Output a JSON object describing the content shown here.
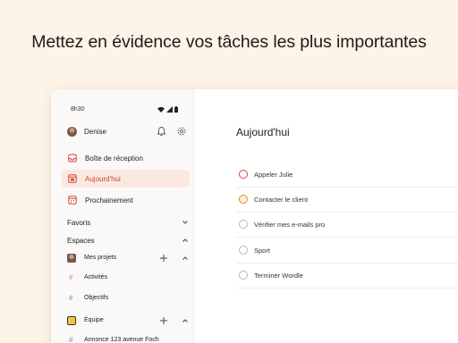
{
  "headline": "Mettez en évidence vos tâches les plus importantes",
  "status_bar": {
    "time": "8h30"
  },
  "user": {
    "name": "Denise"
  },
  "nav": [
    {
      "label": "Boîte de réception",
      "icon": "inbox-icon"
    },
    {
      "label": "Aujourd'hui",
      "icon": "today-calendar-icon",
      "active": true
    },
    {
      "label": "Prochainement",
      "icon": "upcoming-calendar-icon"
    }
  ],
  "sections": {
    "favorites": "Favoris",
    "spaces": "Espaces"
  },
  "projects": {
    "personal": {
      "label": "Mes projets",
      "items": [
        "Activités",
        "Objectifs"
      ]
    },
    "team": {
      "label": "Équipe",
      "items": [
        "Annonce 123 avenue Foch"
      ]
    }
  },
  "main": {
    "title": "Aujourd'hui",
    "tasks": [
      {
        "label": "Appeler Julie",
        "priority_color": "#d1453b"
      },
      {
        "label": "Contacter le client",
        "priority_color": "#eb8909"
      },
      {
        "label": "Vérifier mes e-mails pro",
        "priority_color": "#b8b8b8"
      },
      {
        "label": "Sport",
        "priority_color": "#b8b8b8"
      },
      {
        "label": "Terminer Wordle",
        "priority_color": "#b8b8b8"
      }
    ]
  },
  "colors": {
    "accent": "#dc4c3e",
    "background": "#fdf3e6",
    "active_nav_bg": "#fbe9e1"
  }
}
